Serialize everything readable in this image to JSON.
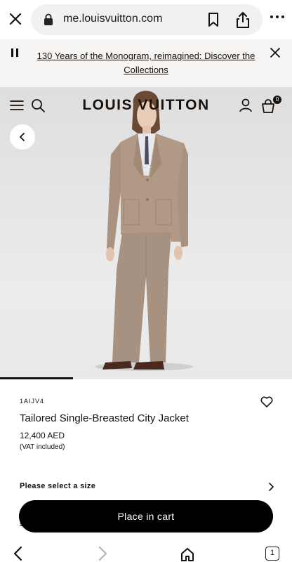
{
  "browser": {
    "url": "me.louisvuitton.com",
    "tab_count": "1"
  },
  "banner": {
    "text": "130 Years of the Monogram, reimagined: Discover the Collections"
  },
  "header": {
    "brand": "LOUIS VUITTON",
    "bag_count": "0"
  },
  "gallery": {
    "progress": 0.25
  },
  "product": {
    "sku": "1AIJV4",
    "name": "Tailored Single-Breasted City Jacket",
    "price": "12,400 AED",
    "vat_note": "(VAT included)",
    "size_prompt": "Please select a size",
    "cta_label": "Place in cart",
    "peek_text": "S"
  },
  "colors": {
    "accent": "#19110b",
    "banner_bg": "#f6f5f3",
    "suit": "#b09a86"
  }
}
